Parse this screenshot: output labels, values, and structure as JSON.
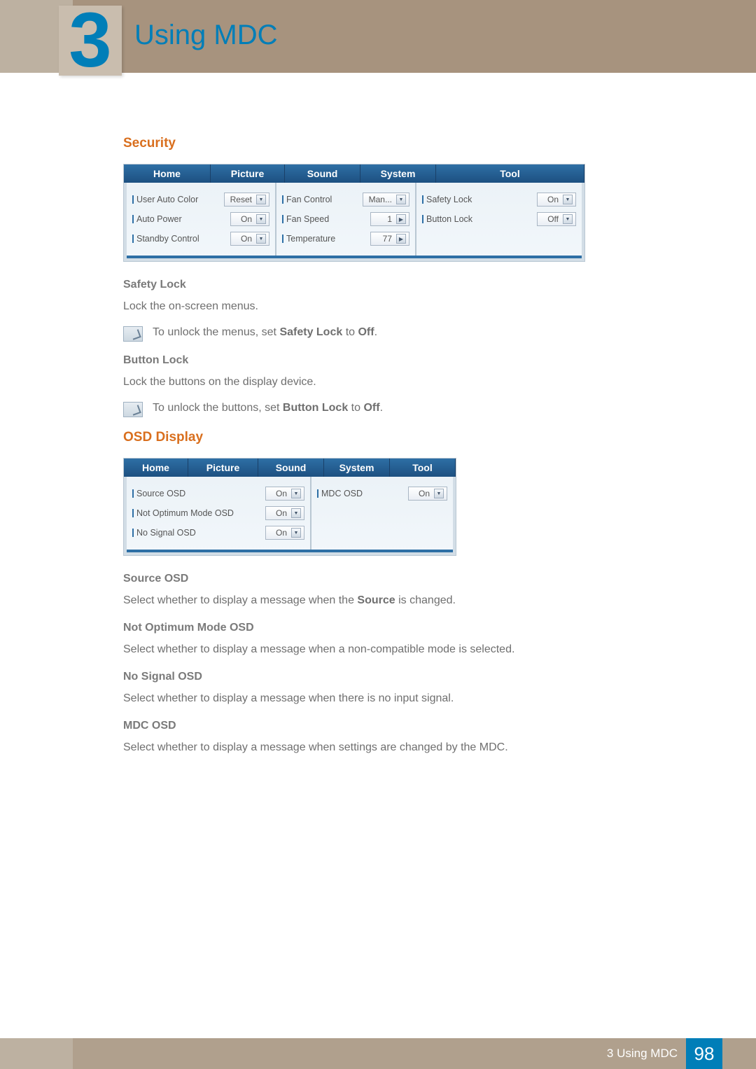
{
  "chapter": {
    "number": "3",
    "title": "Using MDC"
  },
  "sections": {
    "security": {
      "heading": "Security",
      "tabs": [
        "Home",
        "Picture",
        "Sound",
        "System",
        "Tool"
      ],
      "col1": [
        {
          "label": "User Auto Color",
          "value": "Reset",
          "kind": "down"
        },
        {
          "label": "Auto Power",
          "value": "On",
          "kind": "down"
        },
        {
          "label": "Standby Control",
          "value": "On",
          "kind": "down"
        }
      ],
      "col2": [
        {
          "label": "Fan Control",
          "value": "Man...",
          "kind": "down"
        },
        {
          "label": "Fan Speed",
          "value": "1",
          "kind": "right"
        },
        {
          "label": "Temperature",
          "value": "77",
          "kind": "right"
        }
      ],
      "col3": [
        {
          "label": "Safety Lock",
          "value": "On",
          "kind": "down"
        },
        {
          "label": "Button Lock",
          "value": "Off",
          "kind": "down"
        }
      ],
      "items": [
        {
          "title": "Safety Lock",
          "body": "Lock the on-screen menus.",
          "note_pre": "To unlock the menus, set ",
          "note_bold": "Safety Lock",
          "note_mid": " to ",
          "note_bold2": "Off",
          "note_post": "."
        },
        {
          "title": "Button Lock",
          "body": "Lock the buttons on the display device.",
          "note_pre": "To unlock the buttons, set ",
          "note_bold": "Button Lock",
          "note_mid": " to ",
          "note_bold2": "Off",
          "note_post": "."
        }
      ]
    },
    "osd": {
      "heading": "OSD Display",
      "tabs": [
        "Home",
        "Picture",
        "Sound",
        "System",
        "Tool"
      ],
      "colA": [
        {
          "label": "Source OSD",
          "value": "On",
          "kind": "down"
        },
        {
          "label": "Not Optimum Mode OSD",
          "value": "On",
          "kind": "down"
        },
        {
          "label": "No Signal OSD",
          "value": "On",
          "kind": "down"
        }
      ],
      "colB": [
        {
          "label": "MDC OSD",
          "value": "On",
          "kind": "down"
        }
      ],
      "items": [
        {
          "title": "Source OSD",
          "body_pre": "Select whether to display a message when the ",
          "body_bold": "Source",
          "body_post": " is changed."
        },
        {
          "title": "Not Optimum Mode OSD",
          "body_pre": "Select whether to display a message when a non-compatible mode is selected.",
          "body_bold": "",
          "body_post": ""
        },
        {
          "title": "No Signal OSD",
          "body_pre": "Select whether to display a message when there is no input signal.",
          "body_bold": "",
          "body_post": ""
        },
        {
          "title": "MDC OSD",
          "body_pre": "Select whether to display a message when settings are changed by the MDC.",
          "body_bold": "",
          "body_post": ""
        }
      ]
    }
  },
  "footer": {
    "left_num": "3",
    "label": "Using MDC",
    "page": "98"
  }
}
